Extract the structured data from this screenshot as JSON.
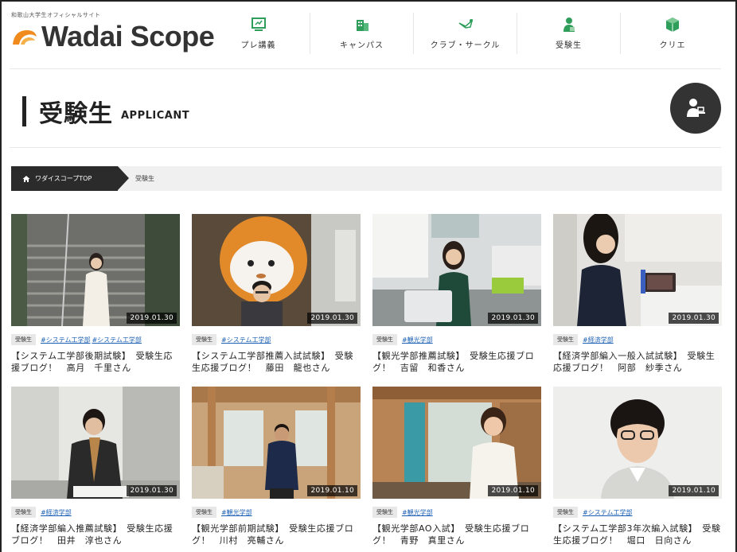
{
  "header": {
    "site_sub": "和歌山大学生オフィシャルサイト",
    "logo_text": "Wadai Scope",
    "nav": [
      {
        "label": "プレ講義",
        "icon": "monitor-icon"
      },
      {
        "label": "キャンパス",
        "icon": "building-icon"
      },
      {
        "label": "クラブ・サークル",
        "icon": "megaphone-icon"
      },
      {
        "label": "受験生",
        "icon": "student-icon"
      },
      {
        "label": "クリエ",
        "icon": "cube-icon"
      }
    ]
  },
  "page": {
    "title_ja": "受験生",
    "title_en": "APPLICANT",
    "badge_icon": "student-desk-icon"
  },
  "breadcrumb": {
    "home": "ワダイスコープTOP",
    "current": "受験生"
  },
  "cards": [
    {
      "date": "2019.01.30",
      "category": "受験生",
      "tags": [
        "#システム工学部",
        "#システム工学部"
      ],
      "title": "【システム工学部後期試験】　受験生応援ブログ！　高月　千里さん"
    },
    {
      "date": "2019.01.30",
      "category": "受験生",
      "tags": [
        "#システム工学部"
      ],
      "title": "【システム工学部推薦入試試験】　受験生応援ブログ！　藤田　龍也さん"
    },
    {
      "date": "2019.01.30",
      "category": "受験生",
      "tags": [
        "#観光学部"
      ],
      "title": "【観光学部推薦試験】　受験生応援ブログ！　吉留　和香さん"
    },
    {
      "date": "2019.01.30",
      "category": "受験生",
      "tags": [
        "#経済学部"
      ],
      "title": "【経済学部編入一般入試試験】　受験生応援ブログ！　阿部　紗季さん"
    },
    {
      "date": "2019.01.30",
      "category": "受験生",
      "tags": [
        "#経済学部"
      ],
      "title": "【経済学部編入推薦試験】　受験生応援ブログ！　田井　淳也さん"
    },
    {
      "date": "2019.01.10",
      "category": "受験生",
      "tags": [
        "#観光学部"
      ],
      "title": "【観光学部前期試験】　受験生応援ブログ！　川村　亮輔さん"
    },
    {
      "date": "2019.01.10",
      "category": "受験生",
      "tags": [
        "#観光学部"
      ],
      "title": "【観光学部AO入試】　受験生応援ブログ！　青野　真里さん"
    },
    {
      "date": "2019.01.10",
      "category": "受験生",
      "tags": [
        "#システム工学部"
      ],
      "title": "【システム工学部3年次編入試験】　受験生応援ブログ！　堀口　日向さん"
    }
  ],
  "colors": {
    "accent_orange": "#f08a1c",
    "tag_link": "#1a5fb4",
    "nav_green": "#2f9e5a"
  }
}
